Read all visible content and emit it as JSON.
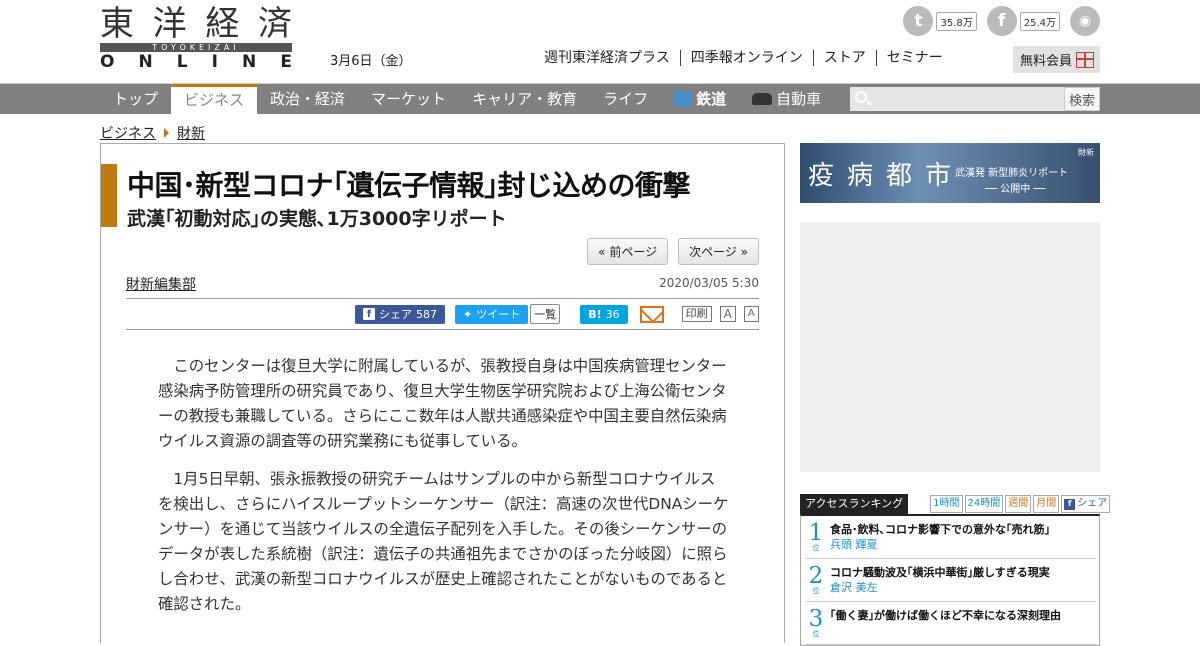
{
  "header": {
    "logo_kanji": [
      "東",
      "洋",
      "経",
      "済"
    ],
    "logo_bar": "TOYOKEIZAI",
    "logo_online": [
      "O",
      "N",
      "L",
      "I",
      "N",
      "E"
    ],
    "date": "3月6日（金）",
    "social": {
      "twitter_count": "35.8万",
      "facebook_count": "25.4万"
    },
    "top_links": [
      "週刊東洋経済プラス",
      "四季報オンライン",
      "ストア",
      "セミナー"
    ],
    "free_member": "無料会員"
  },
  "catnav": {
    "items": [
      {
        "label": "トップ"
      },
      {
        "label": "ビジネス"
      },
      {
        "label": "政治・経済"
      },
      {
        "label": "マーケット"
      },
      {
        "label": "キャリア・教育"
      },
      {
        "label": "ライフ"
      },
      {
        "label": "鉄道"
      },
      {
        "label": "自動車"
      }
    ],
    "search_button": "検索"
  },
  "breadcrumb": [
    "ビジネス",
    "財新"
  ],
  "article": {
    "title": "中国･新型コロナ｢遺伝子情報｣封じ込めの衝撃",
    "subtitle": "武漢｢初動対応｣の実態､1万3000字リポート",
    "prev_page": "« 前ページ",
    "next_page": "次ページ »",
    "author": "財新編集部",
    "published": "2020/03/05 5:30",
    "share": {
      "facebook_label": "シェア",
      "facebook_count": "587",
      "tweet_label": "ツイート",
      "tweet_count": "一覧",
      "hatena_label": "B!",
      "hatena_count": "36",
      "print": "印刷",
      "font_large": "A",
      "font_small": "A"
    },
    "paragraphs": [
      "このセンターは復旦大学に附属しているが、張教授自身は中国疾病管理センター感染病予防管理所の研究員であり、復旦大学生物医学研究院および上海公衛センターの教授も兼職している。さらにここ数年は人獣共通感染症や中国主要自然伝染病ウイルス資源の調査等の研究業務にも従事している。",
      "1月5日早朝、張永振教授の研究チームはサンプルの中から新型コロナウイルスを検出し、さらにハイスループットシーケンサー（訳注：高速の次世代DNAシーケンサー）を通じて当該ウイルスの全遺伝子配列を入手した。その後シーケンサーのデータが表した系統樹（訳注：遺伝子の共通祖先までさかのぼった分岐図）に照らし合わせ、武漢の新型コロナウイルスが歴史上確認されたことがないものであると確認された。"
    ]
  },
  "sidebar": {
    "banner": {
      "title": "疫病都市",
      "tag": "財新",
      "subtitle": "武漢発 新型肺炎リポート",
      "open": "── 公開中 ──"
    },
    "ranking": {
      "title": "アクセスランキング",
      "tabs": [
        "1時間",
        "24時間",
        "週間",
        "月間",
        "シェア"
      ],
      "items": [
        {
          "rank": "1",
          "suffix": "位",
          "headline": "食品･飲料､コロナ影響下での意外な｢売れ筋｣",
          "author": "兵頭 輝夏"
        },
        {
          "rank": "2",
          "suffix": "位",
          "headline": "コロナ騒動波及｢横浜中華街｣厳しすぎる現実",
          "author": "倉沢 美左"
        },
        {
          "rank": "3",
          "suffix": "位",
          "headline": "｢働く妻｣が働けば働くほど不幸になる深刻理由",
          "author": ""
        }
      ]
    }
  }
}
